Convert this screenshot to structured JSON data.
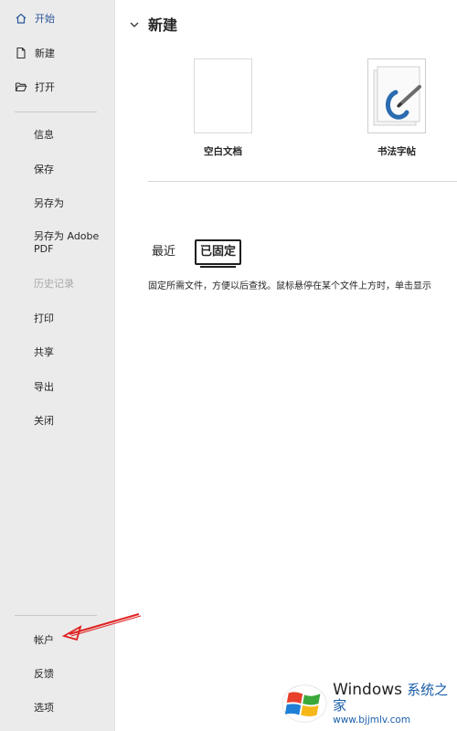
{
  "sidebar": {
    "top_items": [
      {
        "label": "开始",
        "icon": "home-icon"
      },
      {
        "label": "新建",
        "icon": "new-document-icon"
      },
      {
        "label": "打开",
        "icon": "open-folder-icon"
      }
    ],
    "sub_items": [
      {
        "label": "信息"
      },
      {
        "label": "保存"
      },
      {
        "label": "另存为"
      },
      {
        "label": "另存为 Adobe PDF"
      },
      {
        "label": "历史记录",
        "disabled": true
      },
      {
        "label": "打印"
      },
      {
        "label": "共享"
      },
      {
        "label": "导出"
      },
      {
        "label": "关闭"
      }
    ],
    "bottom_items": [
      {
        "label": "帐户"
      },
      {
        "label": "反馈"
      },
      {
        "label": "选项"
      }
    ]
  },
  "main": {
    "section_title": "新建",
    "templates": [
      {
        "label": "空白文档"
      },
      {
        "label": "书法字帖"
      }
    ],
    "tabs": [
      {
        "label": "最近",
        "selected": false
      },
      {
        "label": "已固定",
        "selected": true
      }
    ],
    "pinned_hint": "固定所需文件，方便以后查找。鼠标悬停在某个文件上方时，单击显示"
  },
  "watermark": {
    "brand": "Windows",
    "cn": "系统之家",
    "url": "www.bjjmlv.com"
  },
  "colors": {
    "accent": "#2b579a",
    "sidebar_bg": "#ebebeb",
    "annotation_arrow": "#e02020"
  }
}
